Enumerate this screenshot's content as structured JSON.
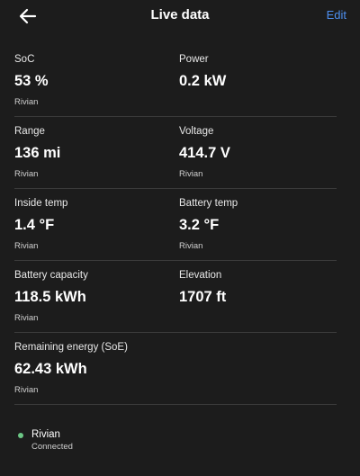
{
  "header": {
    "title": "Live data",
    "edit_label": "Edit",
    "back_icon": "arrow-left-icon"
  },
  "rows": [
    {
      "left": {
        "label": "SoC",
        "value": "53 %",
        "source": "Rivian"
      },
      "right": {
        "label": "Power",
        "value": "0.2 kW",
        "source": ""
      }
    },
    {
      "left": {
        "label": "Range",
        "value": "136 mi",
        "source": "Rivian"
      },
      "right": {
        "label": "Voltage",
        "value": "414.7 V",
        "source": "Rivian"
      }
    },
    {
      "left": {
        "label": "Inside temp",
        "value": "1.4 °F",
        "source": "Rivian"
      },
      "right": {
        "label": "Battery temp",
        "value": "3.2 °F",
        "source": "Rivian"
      }
    },
    {
      "left": {
        "label": "Battery capacity",
        "value": "118.5 kWh",
        "source": "Rivian"
      },
      "right": {
        "label": "Elevation",
        "value": "1707 ft",
        "source": ""
      }
    },
    {
      "left": {
        "label": "Remaining energy (SoE)",
        "value": "62.43 kWh",
        "source": "Rivian"
      }
    }
  ],
  "device": {
    "name": "Rivian",
    "status": "Connected",
    "status_color": "#6cc785"
  },
  "colors": {
    "background": "#1c1c1c",
    "accent": "#4d8ff0",
    "divider": "#3a3a3a"
  }
}
